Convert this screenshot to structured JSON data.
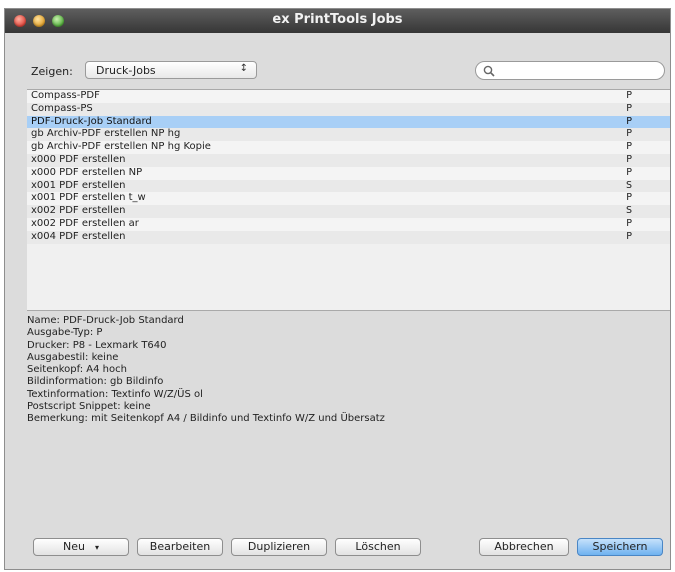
{
  "window": {
    "title": "ex PrintTools Jobs"
  },
  "toolbar": {
    "show_label": "Zeigen:",
    "show_value": "Druck-Jobs"
  },
  "search": {
    "placeholder": ""
  },
  "jobs": [
    {
      "name": "Compass-PDF",
      "type": "P"
    },
    {
      "name": "Compass-PS",
      "type": "P"
    },
    {
      "name": "PDF-Druck-Job Standard",
      "type": "P"
    },
    {
      "name": "gb Archiv-PDF erstellen NP hg",
      "type": "P"
    },
    {
      "name": "gb Archiv-PDF erstellen NP hg  Kopie",
      "type": "P"
    },
    {
      "name": "x000 PDF erstellen",
      "type": "P"
    },
    {
      "name": "x000 PDF erstellen NP",
      "type": "P"
    },
    {
      "name": "x001 PDF erstellen",
      "type": "S"
    },
    {
      "name": "x001 PDF erstellen t_w",
      "type": "P"
    },
    {
      "name": "x002 PDF erstellen",
      "type": "S"
    },
    {
      "name": "x002 PDF erstellen ar",
      "type": "P"
    },
    {
      "name": "x004 PDF erstellen",
      "type": "P"
    }
  ],
  "details": [
    "Name: PDF-Druck-Job Standard",
    "Ausgabe-Typ: P",
    "Drucker: P8 - Lexmark T640",
    "Ausgabestil: keine",
    "Seitenkopf: A4 hoch",
    "Bildinformation: gb Bildinfo",
    "Textinformation: Textinfo W/Z/ÜS ol",
    "Postscript Snippet: keine",
    "Bemerkung: mit Seitenkopf A4 / Bildinfo und Textinfo W/Z und Übersatz"
  ],
  "buttons": {
    "new": "Neu",
    "edit": "Bearbeiten",
    "duplicate": "Duplizieren",
    "delete": "Löschen",
    "cancel": "Abbrechen",
    "save": "Speichern"
  }
}
